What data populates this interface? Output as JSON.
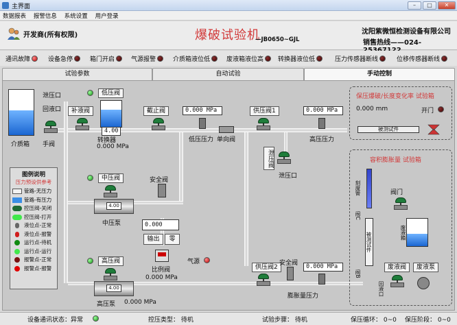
{
  "window": {
    "title": "主界面",
    "min": "–",
    "max": "□",
    "close": "✕"
  },
  "menu": [
    "数据报表",
    "报警信息",
    "系统设置",
    "用户登录"
  ],
  "header": {
    "user": "开发商(所有权限)",
    "title": "爆破试验机",
    "model": "—JB0650~GJL",
    "company": "沈阳紫微恒检测设备有限公司",
    "hotline": "销售热线——024-25367122"
  },
  "alarms": [
    {
      "label": "通讯故障",
      "color": "#d10000"
    },
    {
      "label": "设备急停",
      "color": "#7a1010"
    },
    {
      "label": "箱门开启",
      "color": "#7a1010"
    },
    {
      "label": "气源报警",
      "color": "#7a1010"
    },
    {
      "label": "介质箱液位低",
      "color": "#7a1010"
    },
    {
      "label": "废液箱液位高",
      "color": "#7a1010"
    },
    {
      "label": "转换器液位低",
      "color": "#7a1010"
    },
    {
      "label": "压力传感器断线",
      "color": "#7a1010"
    },
    {
      "label": "位移传感器断线",
      "color": "#7a1010"
    }
  ],
  "tabs": [
    "试验参数",
    "自动试验",
    "手动控制"
  ],
  "canvas": {
    "medium_tank": "介质箱",
    "outlet": "泄压口",
    "return": "回液口",
    "hand_valve": "手阀",
    "fill_valve": "补液阀",
    "low_valve": "低压阀",
    "converter": "转换器",
    "converter_disp": "4.00",
    "converter_pressure": "0.000 MPa",
    "stop_valve": "截止阀",
    "low_pressure_readout": "0.000 MPa",
    "low_pressure": "低压压力",
    "check_valve": "单向阀",
    "supply_valve1": "供压阀1",
    "high_pressure_readout": "0.000 MPa",
    "high_pressure": "高压压力",
    "relief_valve": "泄压阀",
    "relief_outlet": "泄压口",
    "mid_valve": "中压阀",
    "safety_valve": "安全阀",
    "mid_pump": "中压泵",
    "mid_pump_disp": "4.00",
    "spin_value": "0.000",
    "output_btn": "输出",
    "zero_btn": "零",
    "high_valve": "高压阀",
    "gas_source": "气源",
    "prop_valve": "比例阀",
    "prop_pressure": "0.000 MPa",
    "high_pump": "高压泵",
    "high_pump_pressure": "0.000 MPa",
    "high_pump_disp": "4.00",
    "supply_valve2": "供压阀2",
    "safety_valve2": "安全阀",
    "expand_readout": "0.000 MPa",
    "expand_pressure": "膨胀量压力",
    "legend_title": "图例说明",
    "legend_sub": "压力预设供参考",
    "legend": [
      {
        "label": "管路-无压力",
        "color": "#f2f2f2"
      },
      {
        "label": "管路-有压力",
        "color": "#3a8ee6"
      },
      {
        "label": "控压阀-关闭",
        "color": "#1f6a35"
      },
      {
        "label": "控压阀-打开",
        "color": "#41e84b"
      },
      {
        "label": "液位点-正常",
        "color": "#666666"
      },
      {
        "label": "液位点-报警",
        "color": "#d01c1c"
      },
      {
        "label": "运行点-待机",
        "color": "#118a11"
      },
      {
        "label": "运行点-运行",
        "color": "#41e84b"
      },
      {
        "label": "报警点-正常",
        "color": "#7a1010"
      },
      {
        "label": "报警点-报警",
        "color": "#e00000"
      }
    ],
    "burst_box_title": "保压爆破/长度变化率  试验箱",
    "burst_mm": "0.000  mm",
    "open_door": "开门",
    "specimen": "被测试件",
    "volume_box_title": "容积膨胀量  试验箱",
    "scale_label": "刻度管",
    "valve_a": "阀门",
    "valve_c": "阀C",
    "valve_b": "阀B",
    "vertical_specimen": "被测试件",
    "waste_tank": "废液箱",
    "waste_valve": "废液阀",
    "waste_pump": "废液泵",
    "return_port": "回液口"
  },
  "status": {
    "comm": "设备通讯状态：异常",
    "control": "控压类型：  待机",
    "step": "试验步骤：  待机",
    "cycle": "保压循环：  0~0",
    "stage": "保压阶段：  0~0"
  }
}
